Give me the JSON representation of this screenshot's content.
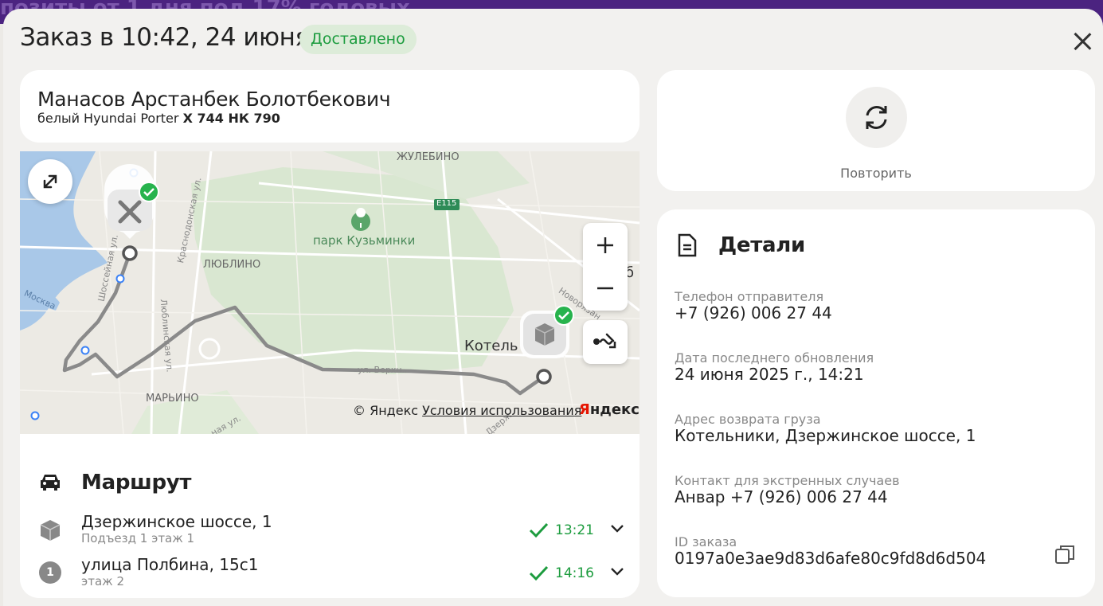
{
  "background": {
    "banner_text": "позиты от 1 дня под 17% годовых"
  },
  "header": {
    "title": "Заказ в 10:42, 24 июня",
    "status": "Доставлено"
  },
  "driver": {
    "name": "Манасов Арстанбек Болотбекович",
    "car_color_model": "белый Hyundai Porter",
    "plate": "Х 744 НК 790"
  },
  "map": {
    "labels": {
      "zhulebino": "ЖУЛЕБИНО",
      "road_e115": "Е115",
      "park": "парк Кузьминки",
      "lyublino": "ЛЮБЛИНО",
      "marino": "МАРЬИНО",
      "kotelniki": "Котель",
      "river": "Москва",
      "shosseynaya": "Шоссейная ул.",
      "krasnodonskaya": "Краснодонская ул.",
      "lyublinskaya": "Люблинская ул.",
      "novoryazanskoe": "Новорязан",
      "ul_verkhn": "ул. Верхн...",
      "dzerzh": "Дзерж",
      "naya": "ная ул.",
      "cut_letter": "б"
    },
    "copyright": "© Яндекс",
    "terms": "Условия использования",
    "logo_red": "Я",
    "logo_rest": "ндекс"
  },
  "route": {
    "title": "Маршрут",
    "stops": [
      {
        "address": "Дзержинское шоссе, 1",
        "details": "Подъезд 1 этаж 1",
        "time": "13:21",
        "marker": ""
      },
      {
        "address": "улица Полбина, 15с1",
        "details": "этаж 2",
        "time": "14:16",
        "marker": "1"
      }
    ]
  },
  "repeat": {
    "label": "Повторить"
  },
  "details": {
    "title": "Детали",
    "fields": [
      {
        "label": "Телефон отправителя",
        "value": "+7 (926) 006 27 44"
      },
      {
        "label": "Дата последнего обновления",
        "value": "24 июня 2025 г., 14:21"
      },
      {
        "label": "Адрес возврата груза",
        "value": "Котельники, Дзержинское шоссе, 1"
      },
      {
        "label": "Контакт для экстренных случаев",
        "value": "Анвар +7 (926) 006 27 44"
      },
      {
        "label": "ID заказа",
        "value": "0197a0e3ae9d83d6afe80c9fd8d6d504"
      }
    ]
  },
  "colors": {
    "accent_green": "#1c9c3e",
    "badge_bg": "#ddecd9",
    "route_line": "#8a8a8a",
    "yandex_red": "#e61400",
    "water": "#a9c8e8",
    "park_green": "#d4e6cc"
  },
  "icons": {
    "close": "close-icon",
    "expand": "expand-icon",
    "zoom_in": "plus-icon",
    "zoom_out": "minus-icon",
    "route": "route-icon",
    "car": "car-icon",
    "package": "package-icon",
    "check": "check-icon",
    "chevron": "chevron-down-icon",
    "repeat": "refresh-icon",
    "document": "document-icon",
    "copy": "copy-icon",
    "tree": "tree-icon"
  }
}
